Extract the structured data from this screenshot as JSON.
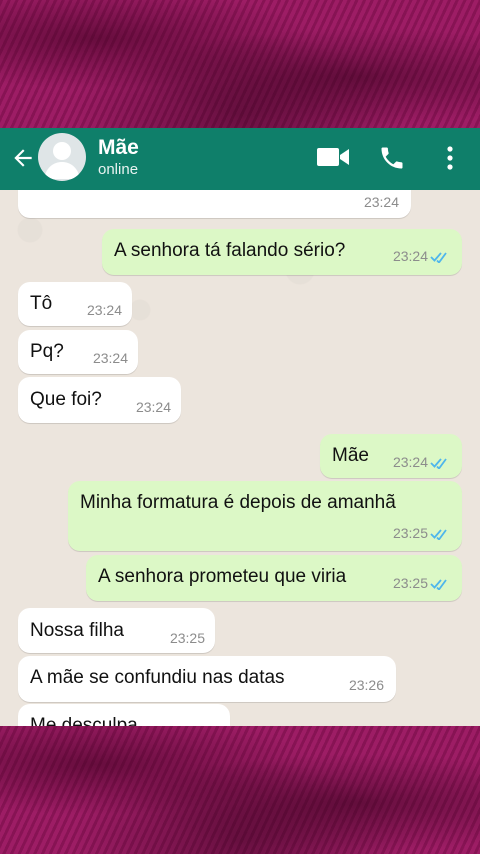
{
  "header": {
    "contact_name": "Mãe",
    "status": "online",
    "colors": {
      "bar": "#0f7f6a",
      "incoming": "#ffffff",
      "outgoing": "#dcf8c6",
      "read_check": "#4fb6ec"
    }
  },
  "messages": [
    {
      "side": "in",
      "text": "",
      "time": "23:24"
    },
    {
      "side": "out",
      "text": "A senhora tá falando sério?",
      "time": "23:24",
      "read": true
    },
    {
      "side": "in",
      "text": "Tô",
      "time": "23:24"
    },
    {
      "side": "in",
      "text": "Pq?",
      "time": "23:24"
    },
    {
      "side": "in",
      "text": "Que foi?",
      "time": "23:24"
    },
    {
      "side": "out",
      "text": "Mãe",
      "time": "23:24",
      "read": true
    },
    {
      "side": "out",
      "text": "Minha formatura é depois de amanhã",
      "time": "23:25",
      "read": true
    },
    {
      "side": "out",
      "text": "A senhora prometeu que viria",
      "time": "23:25",
      "read": true
    },
    {
      "side": "in",
      "text": "Nossa filha",
      "time": "23:25"
    },
    {
      "side": "in",
      "text": "A mãe se confundiu nas datas",
      "time": "23:26"
    },
    {
      "side": "in",
      "text": "Me desculpa",
      "time": ""
    }
  ]
}
